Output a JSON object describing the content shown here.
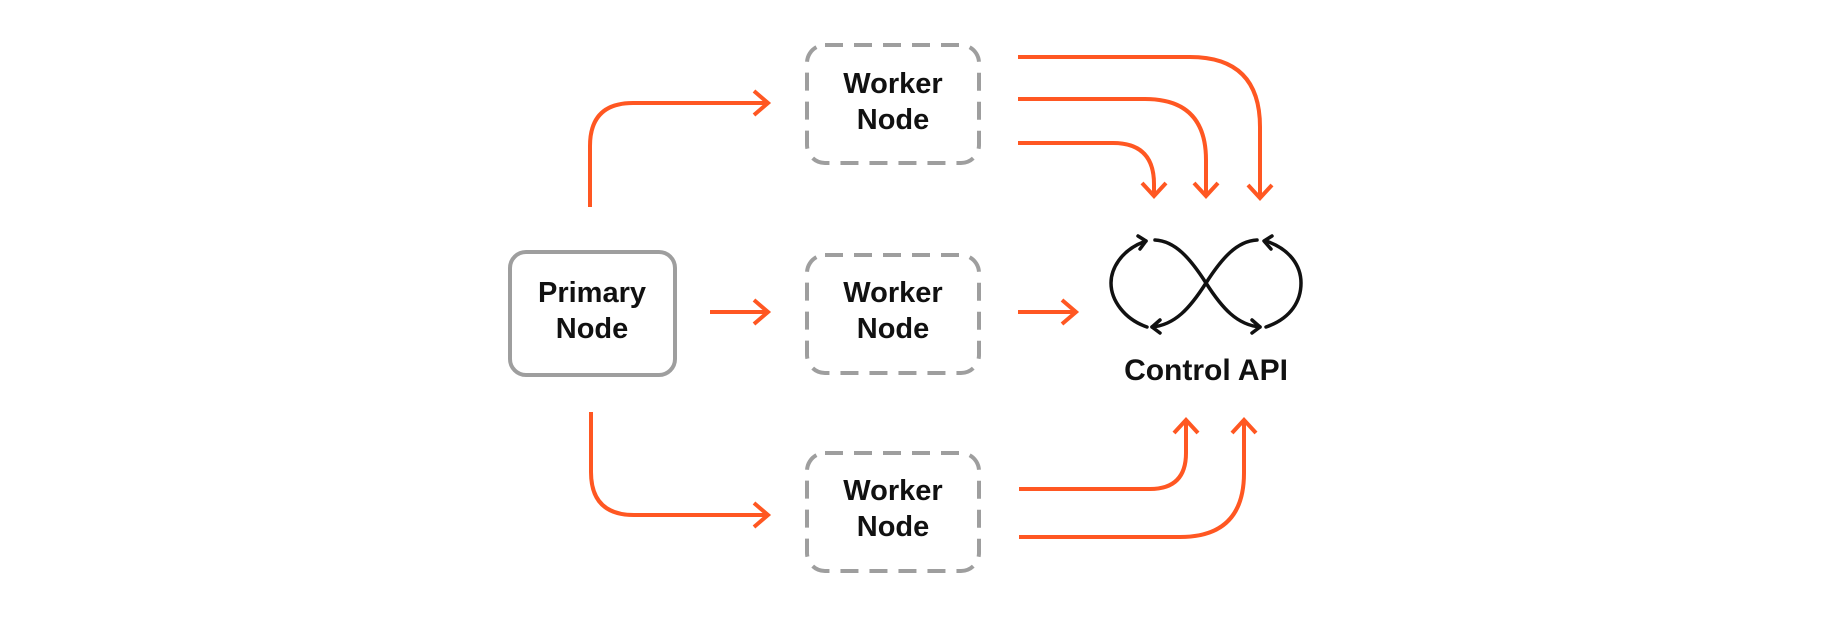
{
  "colors": {
    "flow_arrow": "#ff5722",
    "node_border": "#9e9e9e",
    "text": "#111111"
  },
  "nodes": {
    "primary": {
      "line1": "Primary",
      "line2": "Node",
      "border": "solid"
    },
    "worker_top": {
      "line1": "Worker",
      "line2": "Node",
      "border": "dashed"
    },
    "worker_middle": {
      "line1": "Worker",
      "line2": "Node",
      "border": "dashed"
    },
    "worker_bottom": {
      "line1": "Worker",
      "line2": "Node",
      "border": "dashed"
    }
  },
  "control_api": {
    "label": "Control API",
    "icon": "infinity-loop-arrows-icon"
  },
  "edges": [
    {
      "from": "primary",
      "to": "worker_top",
      "count": 1
    },
    {
      "from": "primary",
      "to": "worker_middle",
      "count": 1
    },
    {
      "from": "primary",
      "to": "worker_bottom",
      "count": 1
    },
    {
      "from": "worker_top",
      "to": "control_api",
      "count": 3
    },
    {
      "from": "worker_middle",
      "to": "control_api",
      "count": 1
    },
    {
      "from": "worker_bottom",
      "to": "control_api",
      "count": 2
    }
  ]
}
